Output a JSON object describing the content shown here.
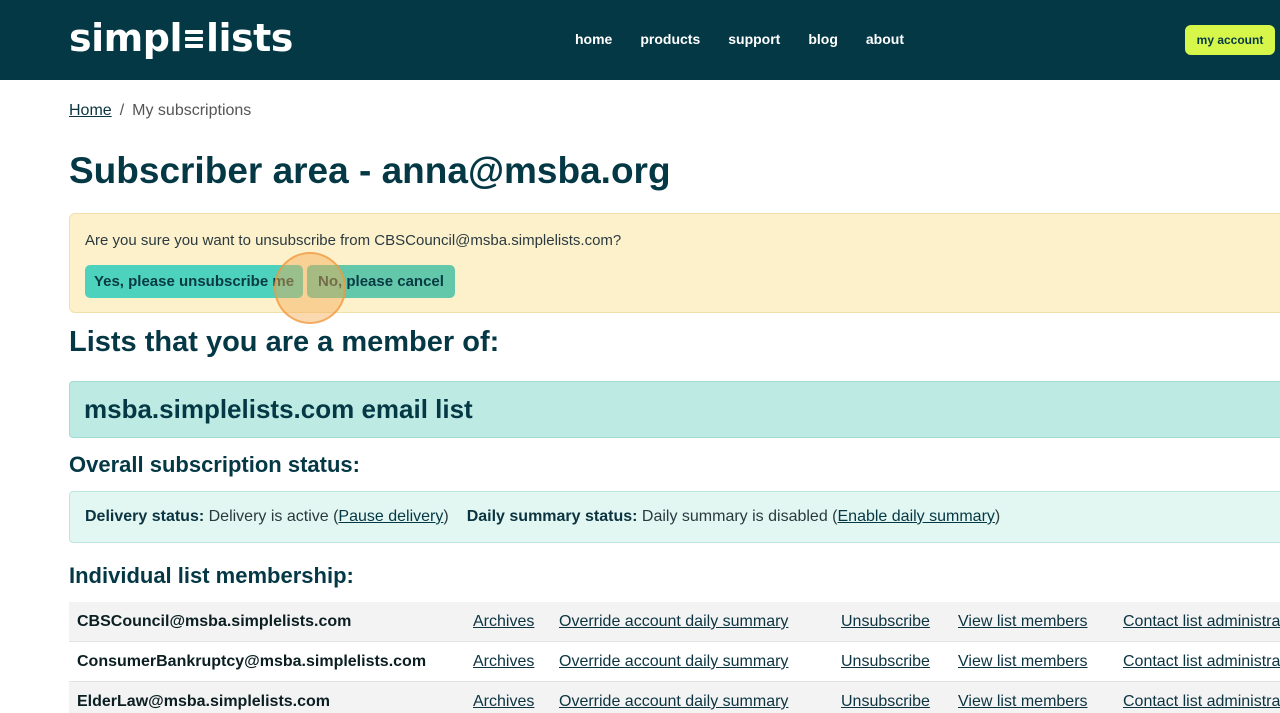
{
  "brand": {
    "logo_left": "simpl",
    "logo_right": "lists"
  },
  "nav": [
    {
      "label": "home"
    },
    {
      "label": "products"
    },
    {
      "label": "support"
    },
    {
      "label": "blog"
    },
    {
      "label": "about"
    }
  ],
  "account_button": "my account",
  "breadcrumb": {
    "home": "Home",
    "separator": "/",
    "current": "My subscriptions"
  },
  "page_title": "Subscriber area - anna@msba.org",
  "confirm": {
    "message": "Are you sure you want to unsubscribe from CBSCouncil@msba.simplelists.com?",
    "yes_label": "Yes, please unsubscribe me",
    "no_label": "No, please cancel"
  },
  "lists_heading": "Lists that you are a member of:",
  "list_banner": "msba.simplelists.com email list",
  "overall_heading": "Overall subscription status:",
  "status": {
    "delivery_label": "Delivery status:",
    "delivery_text": " Delivery is active (",
    "delivery_link": "Pause delivery",
    "delivery_close": ")",
    "summary_label": "Daily summary status:",
    "summary_text": " Daily summary is disabled (",
    "summary_link": "Enable daily summary",
    "summary_close": ")"
  },
  "individual_heading": "Individual list membership:",
  "memberships": [
    {
      "name": "CBSCouncil@msba.simplelists.com",
      "archives": "Archives",
      "override": "Override account daily summary",
      "unsubscribe": "Unsubscribe",
      "members": "View list members",
      "contact": "Contact list administrator"
    },
    {
      "name": "ConsumerBankruptcy@msba.simplelists.com",
      "archives": "Archives",
      "override": "Override account daily summary",
      "unsubscribe": "Unsubscribe",
      "members": "View list members",
      "contact": "Contact list administrator"
    },
    {
      "name": "ElderLaw@msba.simplelists.com",
      "archives": "Archives",
      "override": "Override account daily summary",
      "unsubscribe": "Unsubscribe",
      "members": "View list members",
      "contact": "Contact list administrator"
    }
  ],
  "colors": {
    "header_bg": "#043845",
    "accent": "#d6f74a",
    "button": "#4dd2bd",
    "warning_bg": "#fdf1cc"
  }
}
